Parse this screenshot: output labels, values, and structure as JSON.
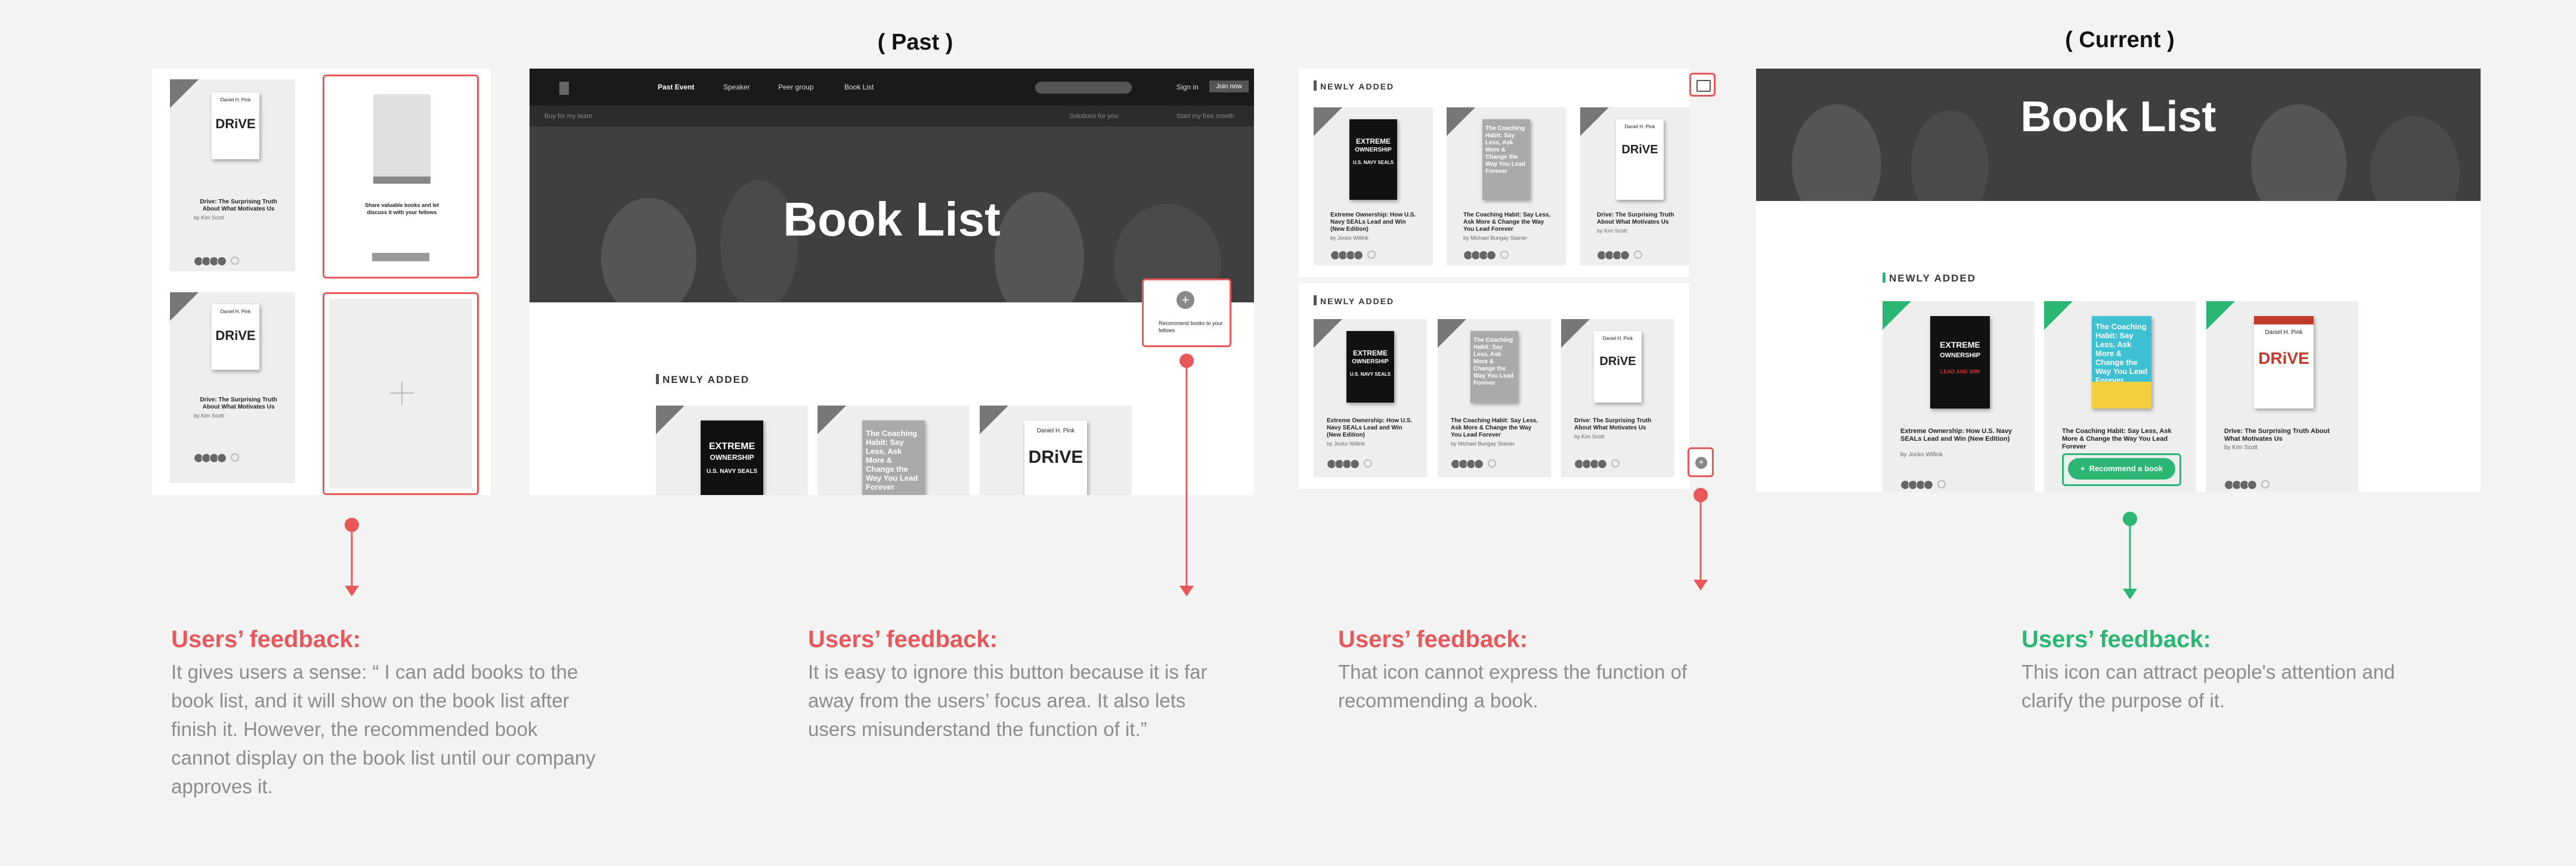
{
  "headings": {
    "past": "( Past )",
    "current": "( Current )"
  },
  "colors": {
    "red": "#e8575a",
    "green": "#2bb673",
    "feedback_text": "#8c8c8c"
  },
  "books": {
    "drive": {
      "title": "Drive: The Surprising Truth About What Motivates Us",
      "author": "by Kim Scott",
      "cover_author": "Daniel H. Pink",
      "cover_word": "DRiVE"
    },
    "extreme": {
      "title": "Extreme Ownership: How U.S. Navy SEALs Lead and Win (New Edition)",
      "author": "by Jocko Willink",
      "cover_line1": "EXTREME",
      "cover_line2": "OWNERSHIP",
      "cover_line3": "U.S. NAVY SEALS",
      "cover_line4": "LEAD AND WIN"
    },
    "coaching": {
      "title": "The Coaching Habit: Say Less, Ask More & Change the Way You Lead Forever",
      "author": "by Michael Bungay Stainer",
      "cover_text": "The Coaching Habit: Say Less, Ask More & Change the Way You Lead Forever"
    }
  },
  "panel1": {
    "share_text": "Share valuable books and let discuss it with your fellows"
  },
  "panel2": {
    "nav": [
      "Past Event",
      "Speaker",
      "Peer group",
      "Book List"
    ],
    "sign_in": "Sign in",
    "join": "Join now",
    "subnav": [
      "Buy for my team",
      "Solutions for you",
      "Start my free month"
    ],
    "hero_title": "Book List",
    "section": "NEWLY ADDED",
    "recommend_text": "Recommend books to your fellows"
  },
  "panel3": {
    "section": "NEWLY ADDED"
  },
  "panel4": {
    "hero_title": "Book List",
    "section": "NEWLY ADDED",
    "recommend_button": "Recommend a book"
  },
  "feedback": [
    {
      "title": "Users’ feedback:",
      "text": "It gives users a sense: “ I can add books to the book list, and it will show on the book list after finish it. However, the recommended book cannot display on the book list until our company approves it."
    },
    {
      "title": "Users’ feedback:",
      "text": "It is easy to ignore this button because it is far away from the users’ focus area. It also lets users misunderstand the function of it.”"
    },
    {
      "title": "Users’ feedback:",
      "text": "That icon cannot express the function of recommending a book."
    },
    {
      "title": "Users’ feedback:",
      "text": "This icon can attract people's attention and clarify the purpose of it."
    }
  ]
}
